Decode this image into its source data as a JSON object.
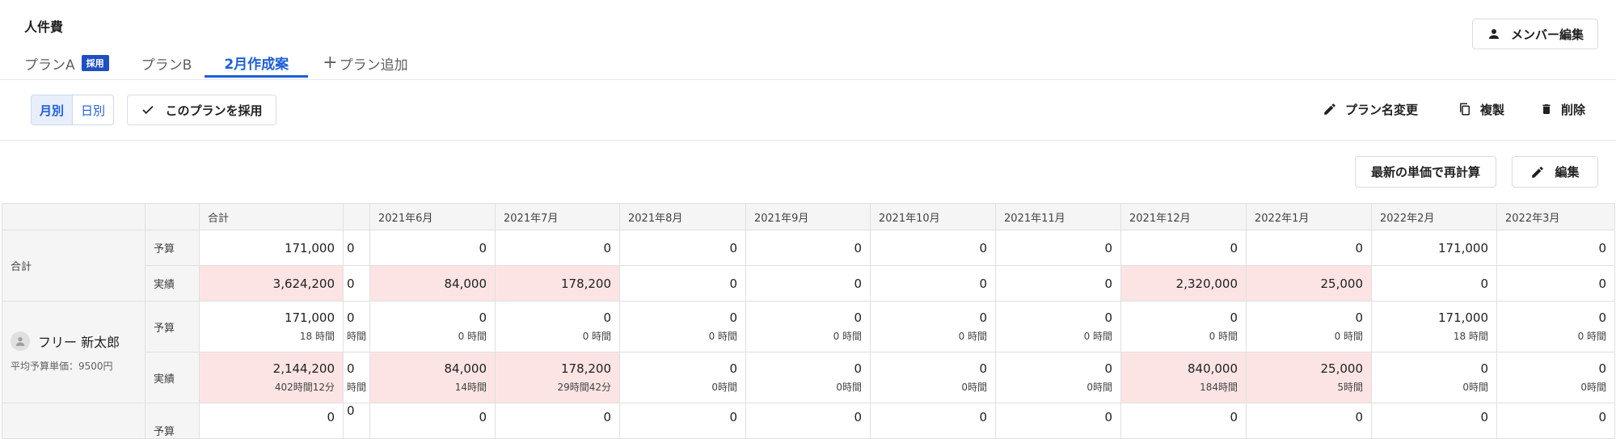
{
  "page": {
    "title": "人件費",
    "member_edit_label": "メンバー編集"
  },
  "tabs": [
    {
      "label": "プランA",
      "badge": "採用"
    },
    {
      "label": "プランB"
    },
    {
      "label": "2月作成案"
    },
    {
      "label": "プラン追加",
      "icon": "plus-icon"
    }
  ],
  "toolbar": {
    "monthly_label": "月別",
    "daily_label": "日別",
    "adopt_label": "このプランを採用",
    "rename_label": "プラン名変更",
    "duplicate_label": "複製",
    "delete_label": "削除",
    "recalc_label": "最新の単価で再計算",
    "edit_label": "編集"
  },
  "table": {
    "headers": [
      "合計",
      "",
      "2021年6月",
      "2021年7月",
      "2021年8月",
      "2021年9月",
      "2021年10月",
      "2021年11月",
      "2021年12月",
      "2022年1月",
      "2022年2月",
      "2022年3月"
    ],
    "total_label": "合計",
    "budget_label": "予算",
    "actual_label": "実績",
    "total_budget": [
      "171,000",
      "0",
      "0",
      "0",
      "0",
      "0",
      "0",
      "0",
      "0",
      "0",
      "171,000",
      "0"
    ],
    "total_actual": [
      "3,624,200",
      "0",
      "84,000",
      "178,200",
      "0",
      "0",
      "0",
      "0",
      "2,320,000",
      "25,000",
      "0",
      "0"
    ],
    "member": {
      "name": "フリー 新太郎",
      "avg_rate": "平均予算単価：9500円",
      "budget": [
        "171,000",
        "0",
        "0",
        "0",
        "0",
        "0",
        "0",
        "0",
        "0",
        "0",
        "171,000",
        "0"
      ],
      "budget_hours": [
        "18 時間",
        "時間",
        "0 時間",
        "0 時間",
        "0 時間",
        "0 時間",
        "0 時間",
        "0 時間",
        "0 時間",
        "0 時間",
        "18 時間",
        "0 時間"
      ],
      "actual": [
        "2,144,200",
        "0",
        "84,000",
        "178,200",
        "0",
        "0",
        "0",
        "0",
        "840,000",
        "25,000",
        "0",
        "0"
      ],
      "actual_hours": [
        "402時間12分",
        "時間",
        "14時間",
        "29時間42分",
        "0時間",
        "0時間",
        "0時間",
        "0時間",
        "184時間",
        "5時間",
        "0時間",
        "0時間"
      ]
    },
    "next_budget": [
      "0",
      "0",
      "0",
      "0",
      "0",
      "0",
      "0",
      "0",
      "0",
      "0",
      "0",
      "0"
    ]
  },
  "colors": {
    "accent": "#1e5fd8",
    "badge": "#1e4fc2",
    "highlight": "#fce4e4",
    "header_bg": "#f5f5f5"
  }
}
